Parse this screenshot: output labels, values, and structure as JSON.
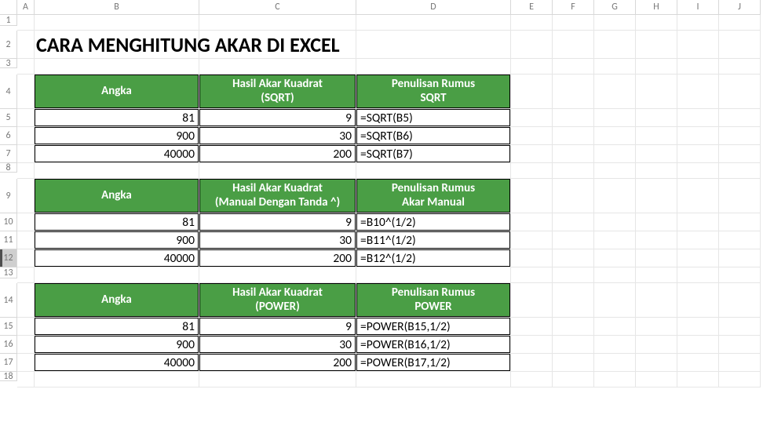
{
  "columns": [
    "A",
    "B",
    "C",
    "D",
    "E",
    "F",
    "G",
    "H",
    "I",
    "J"
  ],
  "row_count": 18,
  "selected_row": 12,
  "title": "CARA MENGHITUNG AKAR DI EXCEL",
  "tables": [
    {
      "headers": {
        "angka": "Angka",
        "hasil": "Hasil Akar Kuadrat\n(SQRT)",
        "rumus": "Penulisan Rumus\nSQRT"
      },
      "rows": [
        {
          "angka": "81",
          "hasil": "9",
          "rumus": "=SQRT(B5)"
        },
        {
          "angka": "900",
          "hasil": "30",
          "rumus": "=SQRT(B6)"
        },
        {
          "angka": "40000",
          "hasil": "200",
          "rumus": "=SQRT(B7)"
        }
      ]
    },
    {
      "headers": {
        "angka": "Angka",
        "hasil": "Hasil Akar Kuadrat\n(Manual Dengan Tanda ^)",
        "rumus": "Penulisan Rumus\nAkar Manual"
      },
      "rows": [
        {
          "angka": "81",
          "hasil": "9",
          "rumus": "=B10^(1/2)"
        },
        {
          "angka": "900",
          "hasil": "30",
          "rumus": "=B11^(1/2)"
        },
        {
          "angka": "40000",
          "hasil": "200",
          "rumus": "=B12^(1/2)"
        }
      ]
    },
    {
      "headers": {
        "angka": "Angka",
        "hasil": "Hasil Akar Kuadrat\n(POWER)",
        "rumus": "Penulisan Rumus\nPOWER"
      },
      "rows": [
        {
          "angka": "81",
          "hasil": "9",
          "rumus": "=POWER(B15,1/2)"
        },
        {
          "angka": "900",
          "hasil": "30",
          "rumus": "=POWER(B16,1/2)"
        },
        {
          "angka": "40000",
          "hasil": "200",
          "rumus": "=POWER(B17,1/2)"
        }
      ]
    }
  ]
}
